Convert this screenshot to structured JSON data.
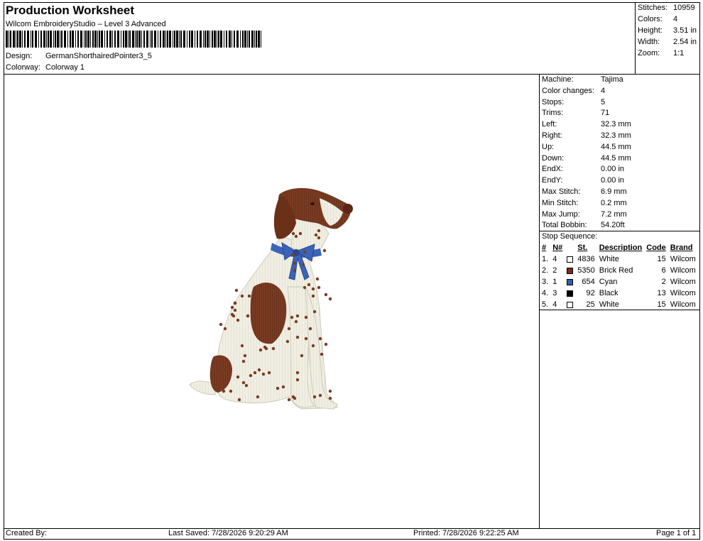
{
  "header": {
    "title": "Production Worksheet",
    "software": "Wilcom EmbroideryStudio – Level 3 Advanced",
    "design_label": "Design:",
    "design_value": "GermanShorthairedPointer3_5",
    "colorway_label": "Colorway:",
    "colorway_value": "Colorway 1"
  },
  "summary": [
    {
      "label": "Stitches:",
      "value": "10959"
    },
    {
      "label": "Colors:",
      "value": "4"
    },
    {
      "label": "Height:",
      "value": "3.51 in"
    },
    {
      "label": "Width:",
      "value": "2.54 in"
    },
    {
      "label": "Zoom:",
      "value": "1:1"
    }
  ],
  "machine_info": [
    {
      "label": "Machine:",
      "value": "Tajima"
    },
    {
      "label": "Color changes:",
      "value": "4"
    },
    {
      "label": "Stops:",
      "value": "5"
    },
    {
      "label": "Trims:",
      "value": "71"
    },
    {
      "label": "Left:",
      "value": "32.3 mm"
    },
    {
      "label": "Right:",
      "value": "32.3 mm"
    },
    {
      "label": "Up:",
      "value": "44.5 mm"
    },
    {
      "label": "Down:",
      "value": "44.5 mm"
    },
    {
      "label": "EndX:",
      "value": "0.00 in"
    },
    {
      "label": "EndY:",
      "value": "0.00 in"
    },
    {
      "label": "Max Stitch:",
      "value": "6.9 mm"
    },
    {
      "label": "Min Stitch:",
      "value": "0.2 mm"
    },
    {
      "label": "Max Jump:",
      "value": "7.2 mm"
    },
    {
      "label": "Total Bobbin:",
      "value": "54.20ft"
    }
  ],
  "stop_sequence": {
    "title": "Stop Sequence:",
    "headers": {
      "num": "#",
      "n": "N#",
      "st": "St.",
      "desc": "Description",
      "code": "Code",
      "brand": "Brand"
    },
    "rows": [
      {
        "num": "1.",
        "n": "4",
        "color": "#ffffff",
        "st": "4836",
        "desc": "White",
        "code": "15",
        "brand": "Wilcom"
      },
      {
        "num": "2.",
        "n": "2",
        "color": "#7a2e1c",
        "st": "5350",
        "desc": "Brick Red",
        "code": "6",
        "brand": "Wilcom"
      },
      {
        "num": "3.",
        "n": "1",
        "color": "#2f5fae",
        "st": "654",
        "desc": "Cyan",
        "code": "2",
        "brand": "Wilcom"
      },
      {
        "num": "4.",
        "n": "3",
        "color": "#000000",
        "st": "92",
        "desc": "Black",
        "code": "13",
        "brand": "Wilcom"
      },
      {
        "num": "5.",
        "n": "4",
        "color": "#ffffff",
        "st": "25",
        "desc": "White",
        "code": "15",
        "brand": "Wilcom"
      }
    ]
  },
  "footer": {
    "created_by": "Created By:",
    "last_saved": "Last Saved: 7/28/2026 9:20:29 AM",
    "printed": "Printed: 7/28/2026 9:22:25 AM",
    "page": "Page 1 of 1"
  },
  "colors": {
    "brown": "#7a3b22",
    "white_thread": "#f3f1e6",
    "blue_bow": "#3b63b8"
  }
}
